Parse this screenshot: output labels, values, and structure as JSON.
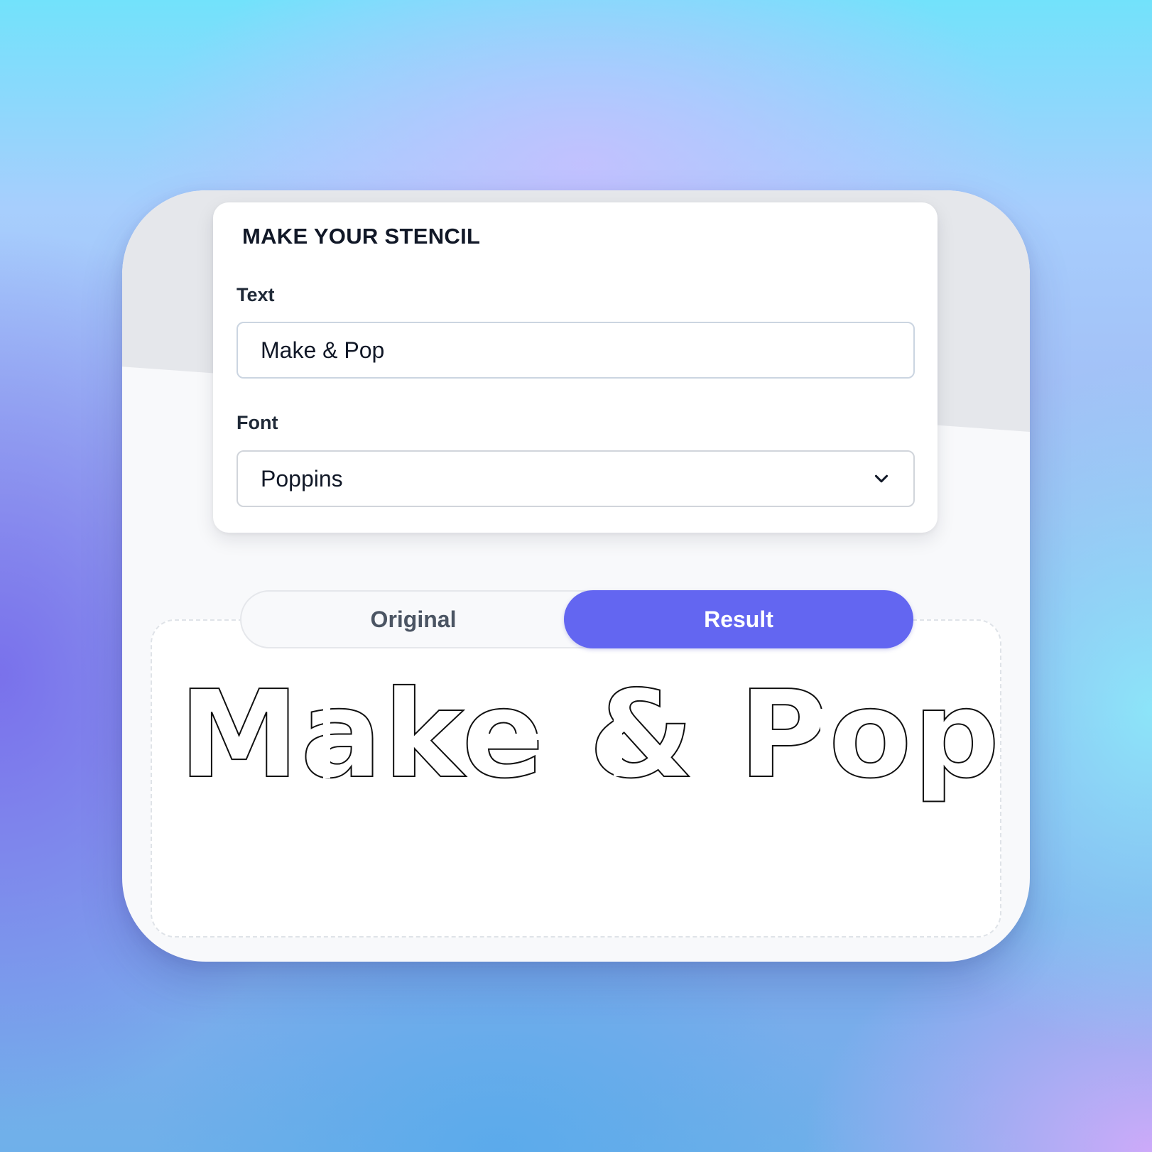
{
  "form": {
    "title": "MAKE YOUR STENCIL",
    "text_label": "Text",
    "text_value": "Make & Pop",
    "font_label": "Font",
    "font_value": "Poppins",
    "font_icon": "chevron-down-icon"
  },
  "toggle": {
    "original_label": "Original",
    "result_label": "Result",
    "active": "Result"
  },
  "preview": {
    "stencil_text": "Make & Pop"
  },
  "colors": {
    "accent": "#6366f1",
    "panel": "#ffffff",
    "card": "#f8f9fb",
    "band": "#e5e7eb",
    "text": "#111827"
  }
}
